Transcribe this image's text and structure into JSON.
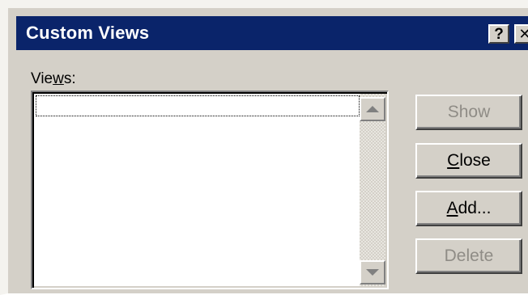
{
  "window": {
    "title": "Custom Views",
    "help_glyph": "?",
    "close_glyph": "✕"
  },
  "views": {
    "label_prefix": "Vie",
    "label_accel": "w",
    "label_suffix": "s:",
    "items": []
  },
  "buttons": {
    "show": {
      "label": "Show",
      "enabled": false
    },
    "close": {
      "accel": "C",
      "rest": "lose",
      "enabled": true
    },
    "add": {
      "accel": "A",
      "rest": "dd...",
      "enabled": true
    },
    "delete": {
      "label": "Delete",
      "enabled": false
    }
  },
  "colors": {
    "titlebar": "#0a246a",
    "face": "#d4d0c8",
    "disabled_text": "#8f8c86"
  }
}
